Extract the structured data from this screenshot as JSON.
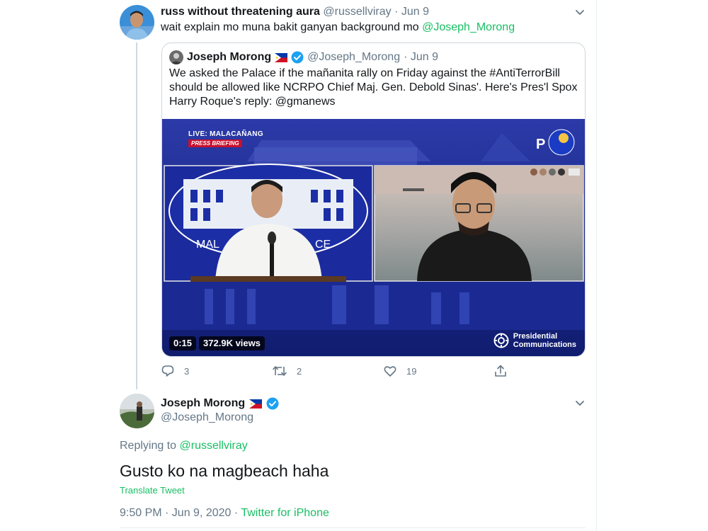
{
  "tweet1": {
    "display_name": "russ without threatening aura",
    "handle": "@russellviray",
    "date": "· Jun 9",
    "text": "wait explain mo muna bakit ganyan background mo",
    "mention": "@Joseph_Morong"
  },
  "quoted": {
    "display_name": "Joseph Morong",
    "handle": "@Joseph_Morong",
    "date": "· Jun 9",
    "text": "We asked the Palace if the mañanita rally on Friday against the #AntiTerrorBill should be allowed like NCRPO Chief Maj. Gen. Debold Sinas'. Here's Pres'l Spox Harry Roque's reply: @gmanews",
    "video": {
      "live_label": "LIVE: MALACAÑANG",
      "press_label": "PRESS BRIEFING",
      "duration": "0:15",
      "views": "372.9K views",
      "logo_line1": "Presidential",
      "logo_line2": "Communications",
      "podium_left": "MAL",
      "podium_right": "CE",
      "corner_logo": "P"
    }
  },
  "actions": {
    "replies": "3",
    "retweets": "2",
    "likes": "19"
  },
  "tweet2": {
    "display_name": "Joseph Morong",
    "handle": "@Joseph_Morong",
    "replying_prefix": "Replying to",
    "replying_to": "@russellviray",
    "text": "Gusto ko na magbeach haha",
    "translate": "Translate Tweet",
    "timestamp": "9:50 PM · Jun 9, 2020 · ",
    "source": "Twitter for iPhone"
  },
  "colors": {
    "link": "#1da1f2",
    "green_link": "#17bf63",
    "muted": "#657786",
    "verified": "#1da1f2"
  }
}
